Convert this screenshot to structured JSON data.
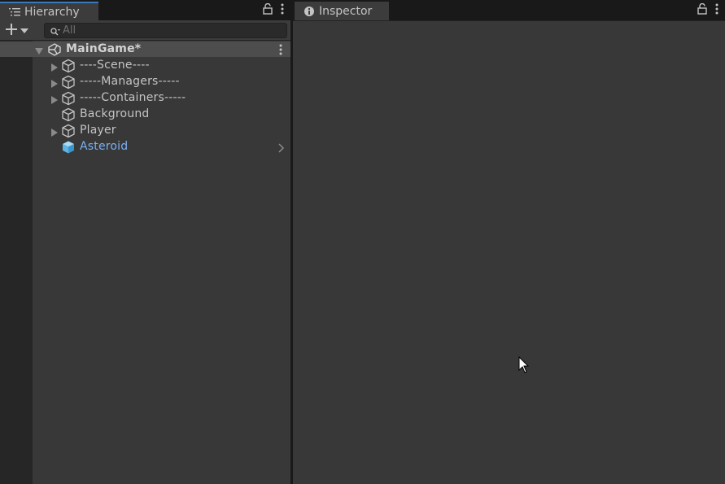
{
  "hierarchy": {
    "tab_label": "Hierarchy",
    "search_placeholder": "All",
    "scene": {
      "label": "MainGame*"
    },
    "items": [
      {
        "label": "----Scene----",
        "has_children": true,
        "selected_style": "normal"
      },
      {
        "label": "-----Managers-----",
        "has_children": true,
        "selected_style": "normal"
      },
      {
        "label": "-----Containers-----",
        "has_children": true,
        "selected_style": "normal"
      },
      {
        "label": "Background",
        "has_children": false,
        "selected_style": "normal"
      },
      {
        "label": "Player",
        "has_children": true,
        "selected_style": "normal"
      },
      {
        "label": "Asteroid",
        "has_children": false,
        "selected_style": "prefab",
        "prefab_color": "#7cb0f2"
      }
    ]
  },
  "inspector": {
    "tab_label": "Inspector"
  },
  "icons": {
    "hierarchy_tab": "list-icon",
    "inspector_tab": "info-icon",
    "lock": "lock-icon",
    "menu": "kebab-menu-icon",
    "add": "plus-icon",
    "search": "search-icon",
    "scene": "unity-logo-icon",
    "gameobject": "cube-icon",
    "prefab": "prefab-cube-icon"
  },
  "colors": {
    "panel_bg": "#383838",
    "tab_bg": "#3c3c3c",
    "active_tab_accent": "#3a79bb",
    "scene_row_bg": "#4d4d4d",
    "prefab_text": "#7cb0f2"
  }
}
